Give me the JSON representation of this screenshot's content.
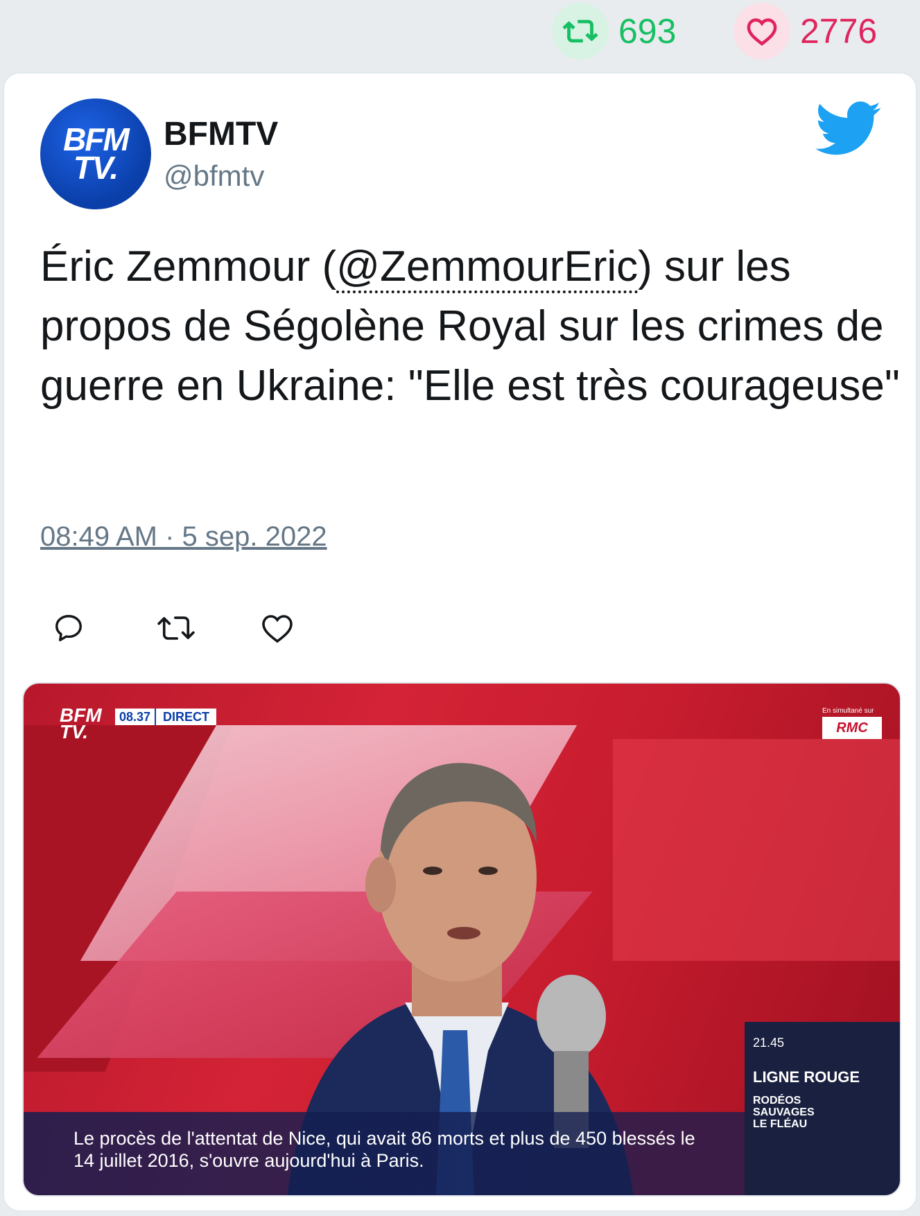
{
  "stats": {
    "retweets": "693",
    "likes": "2776",
    "retweet_color": "#17bf63",
    "like_color": "#e0245e"
  },
  "tweet": {
    "display_name": "BFMTV",
    "handle": "@bfmtv",
    "avatar_text_line1": "BFM",
    "avatar_text_line2": "TV.",
    "text_before": "Éric Zemmour (",
    "mention": "@ZemmourEric",
    "text_after": ") sur les propos de Ségolène Royal sur les crimes de guerre en Ukraine: \"Elle est très courageuse\"",
    "timestamp": "08:49 AM · 5 sep. 2022",
    "actions": [
      "reply-icon",
      "retweet-icon",
      "like-icon"
    ],
    "brand_icon": "twitter-bird-icon",
    "brand_color": "#1da1f2"
  },
  "media": {
    "channel_logo_line1": "BFM",
    "channel_logo_line2": "TV.",
    "live_time": "08.37",
    "live_label": "DIRECT",
    "simulcast_label": "En simultané sur",
    "simulcast_logo": "RMC",
    "ticker_line1": "Le procès de l'attentat de Nice, qui avait 86 morts et plus de 450 blessés le",
    "ticker_line2": "14 juillet 2016, s'ouvre aujourd'hui à Paris.",
    "promo_time": "21.45",
    "promo_title": "LIGNE ROUGE",
    "promo_sub1": "RODÉOS",
    "promo_sub2": "SAUVAGES",
    "promo_sub3": "LE FLÉAU"
  }
}
